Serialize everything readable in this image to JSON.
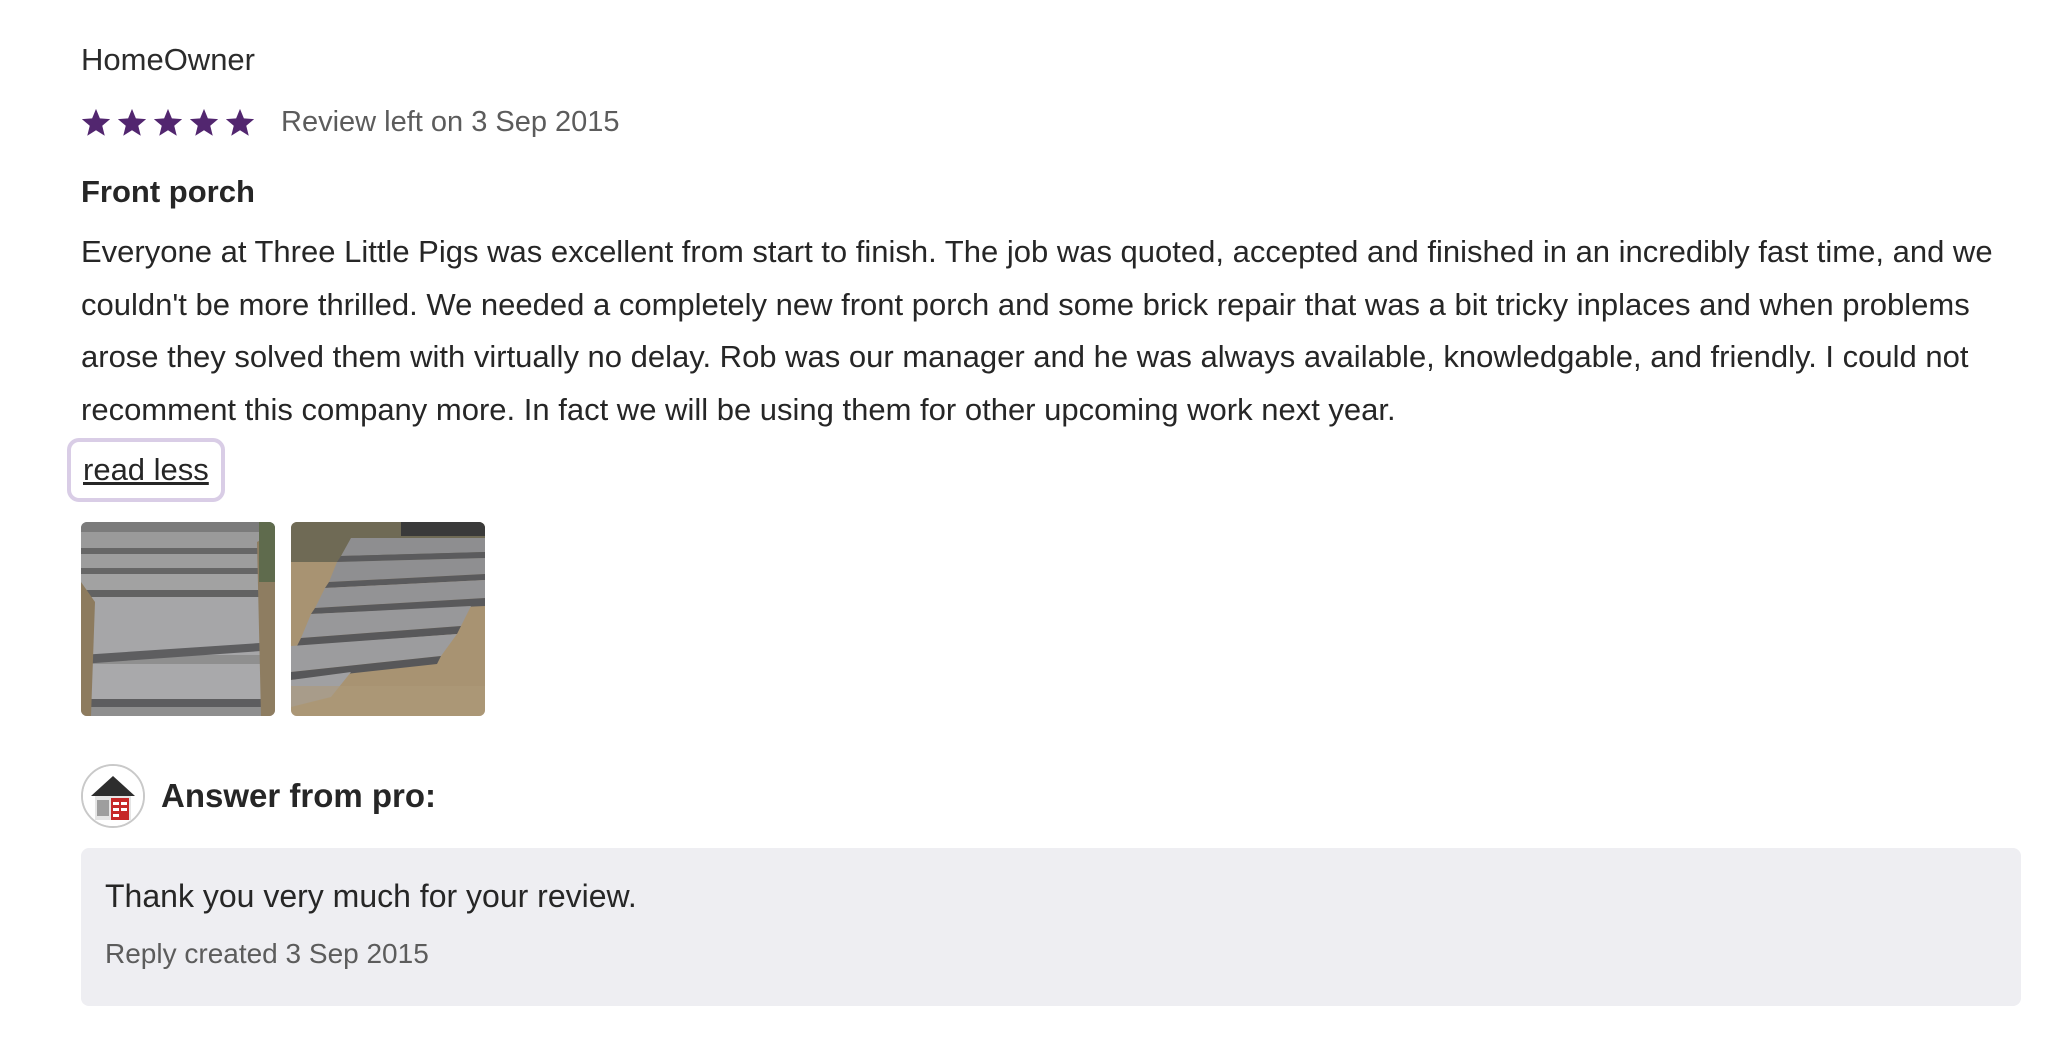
{
  "review": {
    "author": "HomeOwner",
    "rating": 5,
    "rating_max": 5,
    "star_color": "#52266f",
    "date_text": "Review left on 3 Sep 2015",
    "title": "Front porch",
    "body": "Everyone at Three Little Pigs was excellent from start to finish. The job was quoted, accepted and finished in an incredibly fast time, and we couldn't be more thrilled. We needed a completely new front porch and some brick repair that was a bit tricky inplaces and when problems arose they solved them with virtually no delay. Rob was our manager and he was always available, knowledgable, and friendly. I could not recomment this company more. In fact we will be using them for other upcoming work next year.",
    "read_less_label": "read less",
    "photos": [
      {
        "name": "photo-front-steps-1"
      },
      {
        "name": "photo-front-steps-2"
      }
    ]
  },
  "answer": {
    "label": "Answer from pro:",
    "avatar": "pro-logo-avatar",
    "text": "Thank you very much for your review.",
    "date_text": "Reply created 3 Sep 2015"
  }
}
